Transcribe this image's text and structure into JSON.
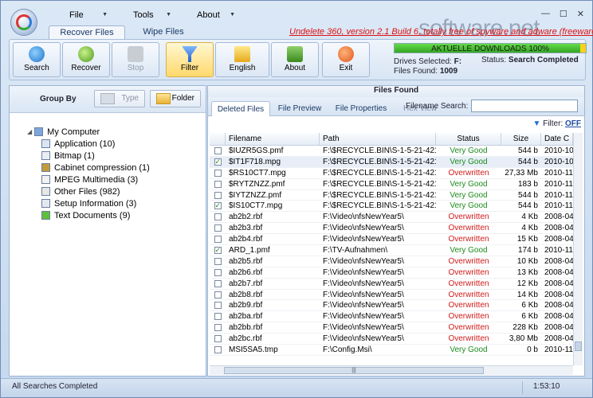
{
  "menu": {
    "file": "File",
    "tools": "Tools",
    "about": "About"
  },
  "window_controls": {
    "min": "—",
    "max": "☐",
    "close": "✕"
  },
  "tabs": [
    "Recover Files",
    "Wipe Files"
  ],
  "title_line": "Undelete 360, version 2.1 Build 6, totally free of spyware and adware (freeware)",
  "watermark": "software.net",
  "ribbon": {
    "buttons": [
      {
        "label": "Search",
        "icon": "search-icon",
        "enabled": true
      },
      {
        "label": "Recover",
        "icon": "recover-icon",
        "enabled": true
      },
      {
        "label": "Stop",
        "icon": "stop-icon",
        "enabled": false
      },
      {
        "label": "Filter",
        "icon": "filter-icon",
        "enabled": true,
        "highlighted": true
      },
      {
        "label": "English",
        "icon": "language-flag-icon",
        "enabled": true
      },
      {
        "label": "About",
        "icon": "about-icon",
        "enabled": true
      },
      {
        "label": "Exit",
        "icon": "exit-icon",
        "enabled": true
      }
    ]
  },
  "status_panel": {
    "progress_text": "AKTUELLE DOWNLOADS 100%",
    "progress": 100,
    "drives_label": "Drives Selected:",
    "drives_value": "F:",
    "files_label": "Files Found:",
    "files_value": "1009",
    "status_label": "Status:",
    "status_value": "Search Completed"
  },
  "group_by": {
    "label": "Group By",
    "type_button": "Type",
    "folder_button": "Folder"
  },
  "tree": {
    "root": "My Computer",
    "items": [
      "Application (10)",
      "Bitmap (1)",
      "Cabinet compression (1)",
      "MPEG Multimedia (3)",
      "Other Files (982)",
      "Setup Information (3)",
      "Text Documents (9)"
    ]
  },
  "files_found_title": "Files Found",
  "subtabs": [
    "Deleted Files",
    "File Preview",
    "File Properties",
    "Hex View"
  ],
  "filename_search_label": "Filename Search:",
  "filename_search_value": "",
  "filter_label": "Filter:",
  "filter_value": "OFF",
  "columns": [
    "Filename",
    "Path",
    "Status",
    "Size",
    "Date C"
  ],
  "rows": [
    {
      "checked": false,
      "name": "$IUZR5GS.pmf",
      "path": "F:\\$RECYCLE.BIN\\S-1-5-21-4215...",
      "status": "Very Good",
      "size": "544 b",
      "date": "2010-10"
    },
    {
      "checked": true,
      "name": "$IT1F718.mpg",
      "path": "F:\\$RECYCLE.BIN\\S-1-5-21-4215...",
      "status": "Very Good",
      "size": "544 b",
      "date": "2010-10"
    },
    {
      "checked": false,
      "name": "$RS10CT7.mpg",
      "path": "F:\\$RECYCLE.BIN\\S-1-5-21-4215...",
      "status": "Overwritten",
      "size": "27,33 Mb",
      "date": "2010-11"
    },
    {
      "checked": false,
      "name": "$RYTZNZZ.pmf",
      "path": "F:\\$RECYCLE.BIN\\S-1-5-21-4215...",
      "status": "Very Good",
      "size": "183 b",
      "date": "2010-11"
    },
    {
      "checked": false,
      "name": "$IYTZNZZ.pmf",
      "path": "F:\\$RECYCLE.BIN\\S-1-5-21-4215...",
      "status": "Very Good",
      "size": "544 b",
      "date": "2010-11"
    },
    {
      "checked": true,
      "name": "$IS10CT7.mpg",
      "path": "F:\\$RECYCLE.BIN\\S-1-5-21-4215...",
      "status": "Very Good",
      "size": "544 b",
      "date": "2010-11"
    },
    {
      "checked": false,
      "name": "ab2b2.rbf",
      "path": "F:\\Video\\nfsNewYear5\\",
      "status": "Overwritten",
      "size": "4 Kb",
      "date": "2008-04"
    },
    {
      "checked": false,
      "name": "ab2b3.rbf",
      "path": "F:\\Video\\nfsNewYear5\\",
      "status": "Overwritten",
      "size": "4 Kb",
      "date": "2008-04"
    },
    {
      "checked": false,
      "name": "ab2b4.rbf",
      "path": "F:\\Video\\nfsNewYear5\\",
      "status": "Overwritten",
      "size": "15 Kb",
      "date": "2008-04"
    },
    {
      "checked": true,
      "name": "ARD_1.pmf",
      "path": "F:\\TV-Aufnahmen\\",
      "status": "Very Good",
      "size": "174 b",
      "date": "2010-11"
    },
    {
      "checked": false,
      "name": "ab2b5.rbf",
      "path": "F:\\Video\\nfsNewYear5\\",
      "status": "Overwritten",
      "size": "10 Kb",
      "date": "2008-04"
    },
    {
      "checked": false,
      "name": "ab2b6.rbf",
      "path": "F:\\Video\\nfsNewYear5\\",
      "status": "Overwritten",
      "size": "13 Kb",
      "date": "2008-04"
    },
    {
      "checked": false,
      "name": "ab2b7.rbf",
      "path": "F:\\Video\\nfsNewYear5\\",
      "status": "Overwritten",
      "size": "12 Kb",
      "date": "2008-04"
    },
    {
      "checked": false,
      "name": "ab2b8.rbf",
      "path": "F:\\Video\\nfsNewYear5\\",
      "status": "Overwritten",
      "size": "14 Kb",
      "date": "2008-04"
    },
    {
      "checked": false,
      "name": "ab2b9.rbf",
      "path": "F:\\Video\\nfsNewYear5\\",
      "status": "Overwritten",
      "size": "6 Kb",
      "date": "2008-04"
    },
    {
      "checked": false,
      "name": "ab2ba.rbf",
      "path": "F:\\Video\\nfsNewYear5\\",
      "status": "Overwritten",
      "size": "6 Kb",
      "date": "2008-04"
    },
    {
      "checked": false,
      "name": "ab2bb.rbf",
      "path": "F:\\Video\\nfsNewYear5\\",
      "status": "Overwritten",
      "size": "228 Kb",
      "date": "2008-04"
    },
    {
      "checked": false,
      "name": "ab2bc.rbf",
      "path": "F:\\Video\\nfsNewYear5\\",
      "status": "Overwritten",
      "size": "3,80 Mb",
      "date": "2008-04"
    },
    {
      "checked": false,
      "name": "MSI5SA5.tmp",
      "path": "F:\\Config.Msi\\",
      "status": "Very Good",
      "size": "0 b",
      "date": "2010-11"
    }
  ],
  "statusbar": {
    "left": "All Searches Completed",
    "right": "1:53:10"
  },
  "colors": {
    "good": "#1c8c1c",
    "overwritten": "#d01a1a",
    "accent": "#1f4c9f"
  }
}
